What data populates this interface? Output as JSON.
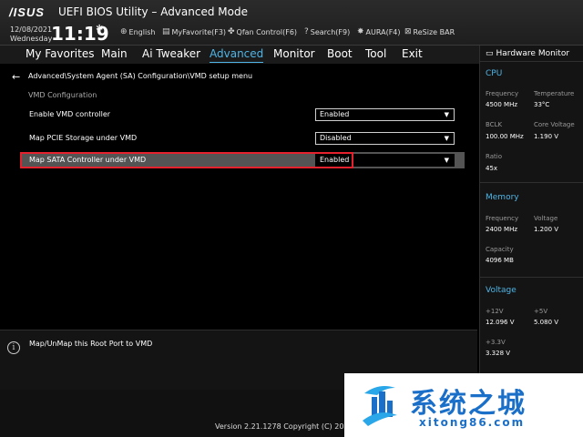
{
  "header": {
    "brand": "/ISUS",
    "title": "UEFI BIOS Utility – Advanced Mode",
    "date": "12/08/2021",
    "weekday": "Wednesday",
    "time": "11:19",
    "tools": [
      {
        "icon": "globe-icon",
        "label": "English"
      },
      {
        "icon": "favorite-icon",
        "label": "MyFavorite(F3)"
      },
      {
        "icon": "fan-icon",
        "label": "Qfan Control(F6)"
      },
      {
        "icon": "search-icon",
        "label": "Search(F9)"
      },
      {
        "icon": "aura-icon",
        "label": "AURA(F4)"
      },
      {
        "icon": "resize-bar-icon",
        "label": "ReSize BAR"
      }
    ]
  },
  "nav": {
    "tabs": [
      "My Favorites",
      "Main",
      "Ai Tweaker",
      "Advanced",
      "Monitor",
      "Boot",
      "Tool",
      "Exit"
    ],
    "active": "Advanced"
  },
  "main": {
    "breadcrumb": "Advanced\\System Agent (SA) Configuration\\VMD setup menu",
    "section": "VMD Configuration",
    "settings": [
      {
        "label": "Enable VMD controller",
        "value": "Enabled"
      },
      {
        "label": "Map PCIE Storage under VMD",
        "value": "Disabled"
      },
      {
        "label": "Map SATA Controller under VMD",
        "value": "Enabled"
      }
    ]
  },
  "help": {
    "text": "Map/UnMap this Root Port to VMD"
  },
  "footer": {
    "version": "Version 2.21.1278 Copyright (C) 202"
  },
  "hardware_monitor": {
    "title": "Hardware Monitor",
    "cpu": {
      "heading": "CPU",
      "frequency_label": "Frequency",
      "frequency": "4500 MHz",
      "temperature_label": "Temperature",
      "temperature": "33°C",
      "bclk_label": "BCLK",
      "bclk": "100.00 MHz",
      "core_voltage_label": "Core Voltage",
      "core_voltage": "1.190 V",
      "ratio_label": "Ratio",
      "ratio": "45x"
    },
    "memory": {
      "heading": "Memory",
      "frequency_label": "Frequency",
      "frequency": "2400 MHz",
      "voltage_label": "Voltage",
      "voltage": "1.200 V",
      "capacity_label": "Capacity",
      "capacity": "4096 MB"
    },
    "voltage": {
      "heading": "Voltage",
      "v12_label": "+12V",
      "v12": "12.096 V",
      "v5_label": "+5V",
      "v5": "5.080 V",
      "v33_label": "+3.3V",
      "v33": "3.328 V"
    }
  },
  "watermark": {
    "cn": "系统之城",
    "url": "xitong86.com"
  },
  "colors": {
    "accent": "#4fb5e6",
    "highlight_border": "#e4212d",
    "watermark_blue": "#1a6fc9"
  }
}
